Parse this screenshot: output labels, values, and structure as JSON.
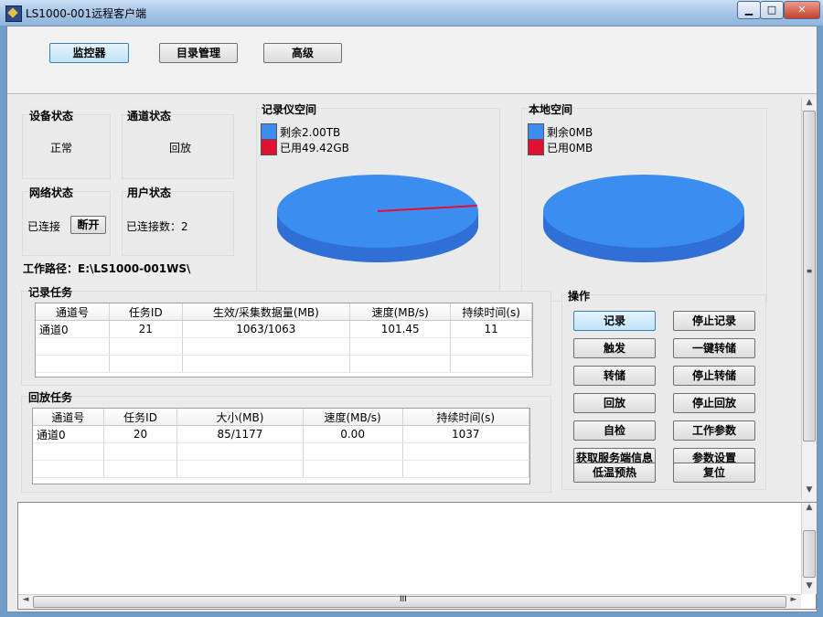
{
  "window": {
    "title": "LS1000-001远程客户端",
    "minimize": "▁",
    "maximize": "□",
    "close": "✕"
  },
  "nav": {
    "monitor": "监控器",
    "directory": "目录管理",
    "advanced": "高级"
  },
  "status": {
    "device": {
      "title": "设备状态",
      "value": "正常"
    },
    "channel": {
      "title": "通道状态",
      "value": "回放"
    },
    "network": {
      "title": "网络状态",
      "value": "已连接",
      "disconnect": "断开"
    },
    "user": {
      "title": "用户状态",
      "value": "已连接数：2"
    }
  },
  "work_path": "工作路径：E:\\LS1000-001WS\\",
  "recorder_space": {
    "title": "记录仪空间",
    "free_label": "剩余2.00TB",
    "used_label": "已用49.42GB",
    "free_color": "#3b8ef0",
    "used_color": "#e01030",
    "used_fraction": 0.024
  },
  "local_space": {
    "title": "本地空间",
    "free_label": "剩余0MB",
    "used_label": "已用0MB",
    "free_color": "#3b8ef0",
    "used_color": "#e01030"
  },
  "record_tasks": {
    "title": "记录任务",
    "columns": [
      "通道号",
      "任务ID",
      "生效/采集数据量(MB)",
      "速度(MB/s)",
      "持续时间(s)"
    ],
    "rows": [
      [
        "通道0",
        "21",
        "1063/1063",
        "101.45",
        "11"
      ]
    ]
  },
  "playback_tasks": {
    "title": "回放任务",
    "columns": [
      "通道号",
      "任务ID",
      "大小(MB)",
      "速度(MB/s)",
      "持续时间(s)"
    ],
    "rows": [
      [
        "通道0",
        "20",
        "85/1177",
        "0.00",
        "1037"
      ]
    ]
  },
  "operations": {
    "title": "操作",
    "buttons": {
      "record": "记录",
      "stop_record": "停止记录",
      "trigger": "触发",
      "one_key_dump": "一键转储",
      "dump": "转储",
      "stop_dump": "停止转储",
      "playback": "回放",
      "stop_playback": "停止回放",
      "self_check": "自检",
      "work_params": "工作参数",
      "get_server_info": "获取服务端信息",
      "param_settings": "参数设置",
      "low_temp_preheat": "低温预热",
      "reset": "复位"
    }
  },
  "scrollbar": {
    "grip": "≡",
    "up": "▲",
    "down": "▼",
    "left": "◄",
    "right": "►",
    "hgrip": "III"
  }
}
